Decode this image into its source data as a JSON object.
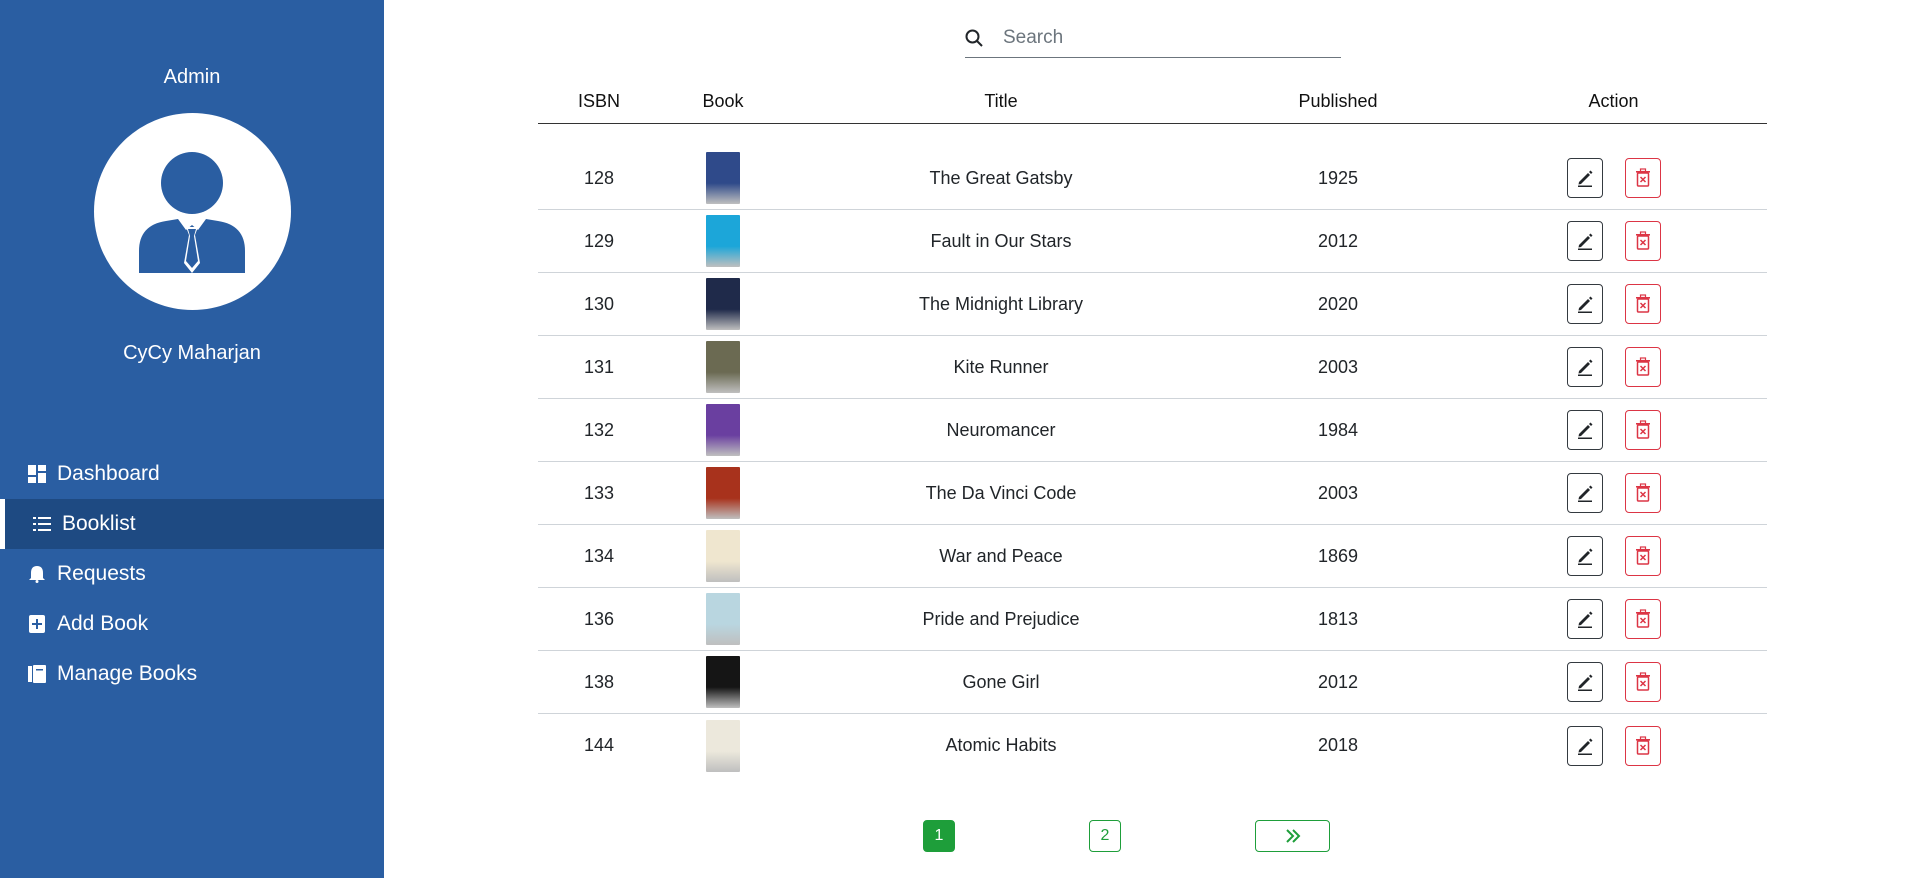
{
  "sidebar": {
    "role": "Admin",
    "username": "CyCy Maharjan",
    "items": [
      {
        "label": "Dashboard",
        "icon": "dashboard-icon"
      },
      {
        "label": "Booklist",
        "icon": "list-icon",
        "active": true
      },
      {
        "label": "Requests",
        "icon": "bell-icon"
      },
      {
        "label": "Add Book",
        "icon": "add-book-icon"
      },
      {
        "label": "Manage Books",
        "icon": "books-icon"
      }
    ]
  },
  "search": {
    "placeholder": "Search",
    "value": ""
  },
  "table": {
    "headers": {
      "isbn": "ISBN",
      "book": "Book",
      "title": "Title",
      "published": "Published",
      "action": "Action"
    },
    "rows": [
      {
        "isbn": "128",
        "title": "The Great Gatsby",
        "published": "1925",
        "cover_color": "#2f4a8a"
      },
      {
        "isbn": "129",
        "title": "Fault in Our Stars",
        "published": "2012",
        "cover_color": "#1ca6d9"
      },
      {
        "isbn": "130",
        "title": "The Midnight Library",
        "published": "2020",
        "cover_color": "#1f2a4a"
      },
      {
        "isbn": "131",
        "title": "Kite Runner",
        "published": "2003",
        "cover_color": "#6b6a52"
      },
      {
        "isbn": "132",
        "title": "Neuromancer",
        "published": "1984",
        "cover_color": "#6a3fa0"
      },
      {
        "isbn": "133",
        "title": "The Da Vinci Code",
        "published": "2003",
        "cover_color": "#a8321c"
      },
      {
        "isbn": "134",
        "title": "War and Peace",
        "published": "1869",
        "cover_color": "#efe6cf"
      },
      {
        "isbn": "136",
        "title": "Pride and Prejudice",
        "published": "1813",
        "cover_color": "#b9d6e0"
      },
      {
        "isbn": "138",
        "title": "Gone Girl",
        "published": "2012",
        "cover_color": "#151515"
      },
      {
        "isbn": "144",
        "title": "Atomic Habits",
        "published": "2018",
        "cover_color": "#ece8dc"
      }
    ]
  },
  "pagination": {
    "pages": [
      "1",
      "2"
    ],
    "current": "1",
    "next": "»"
  },
  "colors": {
    "sidebar": "#2a5ea2",
    "sidebar_active": "#1e4a82",
    "page_active": "#1e9e3a",
    "delete": "#dc3545"
  }
}
